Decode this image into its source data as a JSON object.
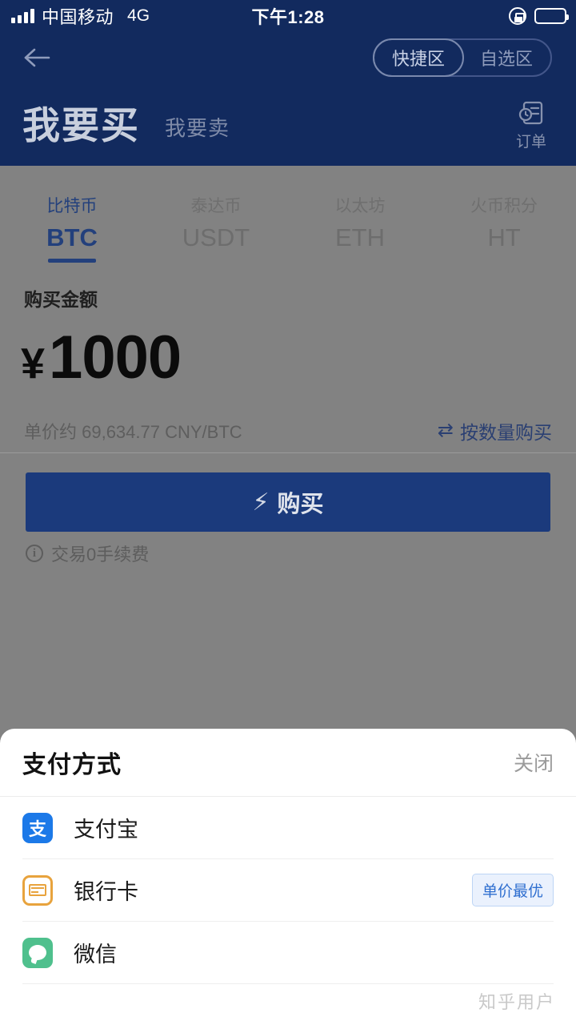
{
  "status_bar": {
    "carrier": "中国移动",
    "network": "4G",
    "time": "下午1:28",
    "rotation_lock_icon": "rotation-lock-icon",
    "battery_icon": "battery-icon"
  },
  "nav": {
    "back_icon": "back-arrow-icon",
    "segments": [
      {
        "label": "快捷区",
        "active": true
      },
      {
        "label": "自选区",
        "active": false
      }
    ]
  },
  "header": {
    "title_buy": "我要买",
    "title_sell": "我要卖",
    "orders_label": "订单",
    "orders_icon": "order-document-clock-icon",
    "background_color": "#122a5e"
  },
  "coin_tabs": [
    {
      "cn": "比特币",
      "symbol": "BTC",
      "active": true
    },
    {
      "cn": "泰达币",
      "symbol": "USDT",
      "active": false
    },
    {
      "cn": "以太坊",
      "symbol": "ETH",
      "active": false
    },
    {
      "cn": "火币积分",
      "symbol": "HT",
      "active": false
    }
  ],
  "form": {
    "amount_label": "购买金额",
    "currency_symbol": "¥",
    "amount_value": "1000",
    "unit_price_text": "单价约 69,634.77 CNY/BTC",
    "switch_mode_label": "按数量购买",
    "switch_mode_icon": "swap-arrows-icon",
    "buy_button_label": "购买",
    "buy_button_icon": "lightning-bolt-icon",
    "fee_note": "交易0手续费",
    "fee_note_icon": "info-circle-icon",
    "accent_color": "#1b3a7c"
  },
  "payment_sheet": {
    "title": "支付方式",
    "close_label": "关闭",
    "methods": [
      {
        "name": "支付宝",
        "icon": "alipay-icon",
        "icon_text": "支",
        "badge": ""
      },
      {
        "name": "银行卡",
        "icon": "bank-card-icon",
        "icon_text": "",
        "badge": "单价最优"
      },
      {
        "name": "微信",
        "icon": "wechat-icon",
        "icon_text": "",
        "badge": ""
      }
    ]
  },
  "watermark": "知乎用户"
}
